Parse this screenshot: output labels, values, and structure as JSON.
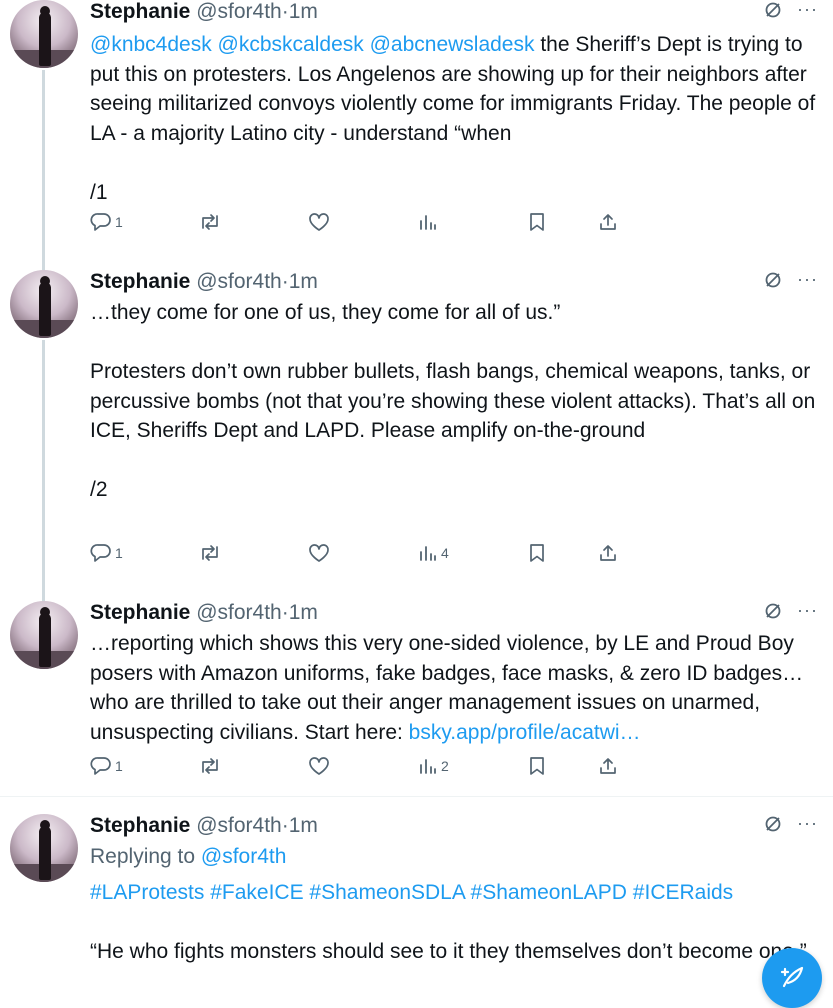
{
  "tweets": [
    {
      "name": "Stephanie",
      "handle": "@sfor4th",
      "sep": "·",
      "time": "1m",
      "mentions": "@knbc4desk @kcbskcaldesk @abcnewsladesk",
      "text": " the Sheriff’s Dept is trying to put this on protesters. Los Angelenos are showing up for their neighbors after seeing militarized convoys violently come for immigrants Friday. The people of LA - a majority Latino city - understand “when",
      "numbering": "/1",
      "replies": "1",
      "reposts": "",
      "likes": "",
      "views": "",
      "more": "···"
    },
    {
      "name": "Stephanie",
      "handle": "@sfor4th",
      "sep": "·",
      "time": "1m",
      "para1": "…they come for one of us, they come for all of us.”",
      "para2": "Protesters don’t own rubber bullets, flash bangs, chemical weapons, tanks, or percussive bombs (not that you’re showing these violent attacks). That’s all on ICE, Sheriffs Dept and LAPD. Please amplify on-the-ground",
      "numbering": "/2",
      "replies": "1",
      "reposts": "",
      "likes": "",
      "views": "4",
      "more": "···"
    },
    {
      "name": "Stephanie",
      "handle": "@sfor4th",
      "sep": "·",
      "time": "1m",
      "text": "…reporting which shows this very one-sided violence, by LE and Proud Boy posers with Amazon uniforms, fake badges, face masks, & zero ID badges…who are thrilled to take out their anger management issues on unarmed, unsuspecting civilians. Start here: ",
      "link": "bsky.app/profile/acatwi…",
      "replies": "1",
      "reposts": "",
      "likes": "",
      "views": "2",
      "more": "···"
    },
    {
      "name": "Stephanie",
      "handle": "@sfor4th",
      "sep": "·",
      "time": "1m",
      "replying_label": "Replying to ",
      "replying_handle": "@sfor4th",
      "hashtags": "#LAProtests #FakeICE #ShameonSDLA #ShameonLAPD #ICERaids",
      "quote": "“He who fights monsters should see to it they themselves don’t become one.”",
      "more": "···"
    }
  ],
  "colors": {
    "accent": "#1d9bf0",
    "muted": "#536471",
    "text": "#0f1419"
  },
  "icons": [
    "reply-icon",
    "repost-icon",
    "like-icon",
    "views-icon",
    "bookmark-icon",
    "share-icon",
    "grok-slash-icon",
    "compose-icon"
  ]
}
